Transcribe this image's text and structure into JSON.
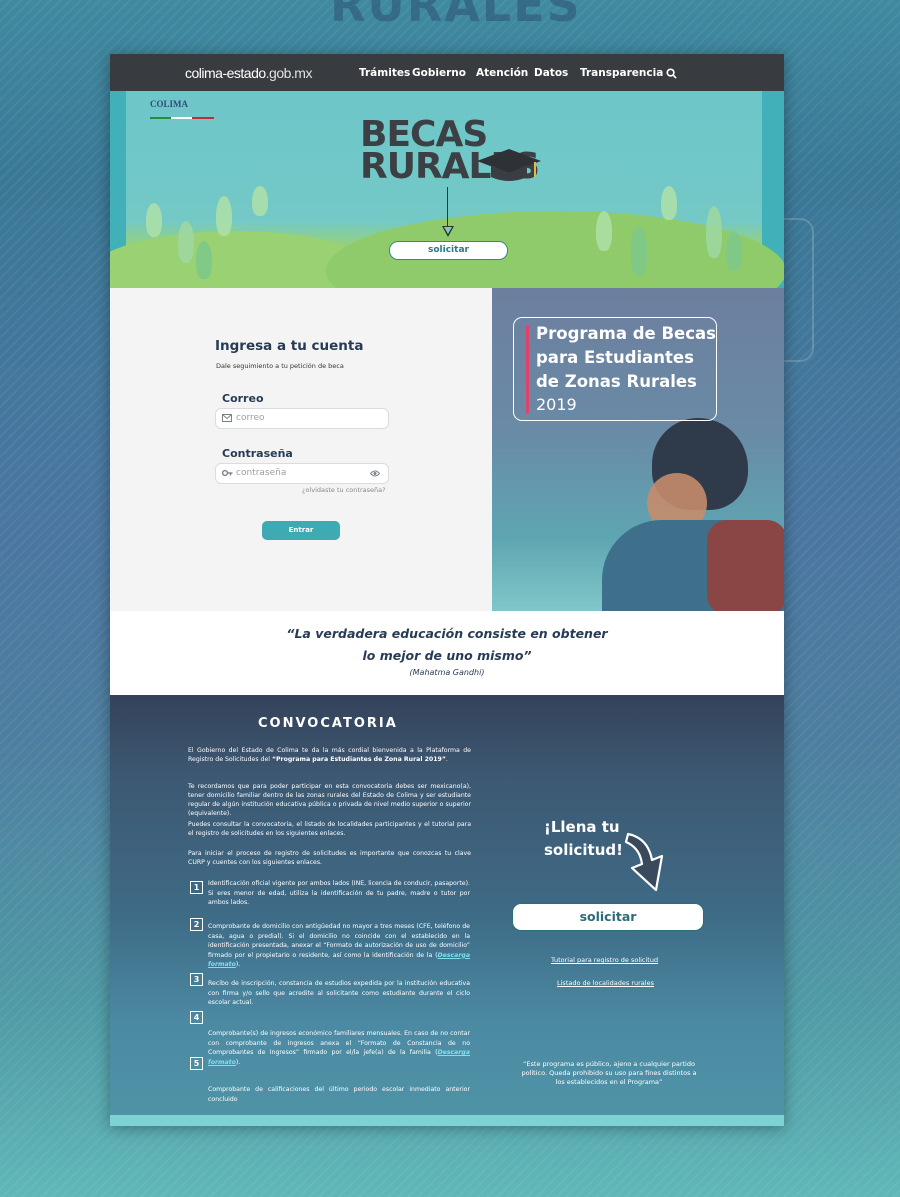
{
  "header": {
    "logo_main": "colima-estado",
    "logo_domain": ".gob.mx",
    "nav": [
      "Trámites",
      "Gobierno",
      "Atención",
      "Datos",
      "Transparencia"
    ]
  },
  "hero": {
    "title_line1": "BECAS",
    "title_line2": "RURALES",
    "badge": "COLIMA",
    "button_label": "solicitar"
  },
  "login": {
    "title": "Ingresa a tu cuenta",
    "subtitle": "Dale seguimiento a tu petición de beca",
    "email_label": "Correo",
    "email_placeholder": "correo",
    "password_label": "Contraseña",
    "password_placeholder": "contraseña",
    "forgot": "¿olvidaste tu contraseña?",
    "submit": "Entrar"
  },
  "program": {
    "title": "Programa de Becas para Estudiantes de Zonas Rurales",
    "year": "2019"
  },
  "quote": {
    "line1": "“La verdadera educación consiste en obtener",
    "line2": "lo mejor de uno mismo”",
    "author": "(Mahatma Gandhi)"
  },
  "convocatoria": {
    "title": "CONVOCATORIA",
    "intro_pre": "El Gobierno del Estado de Colima te da la más cordial bienvenida a la Plataforma de Registro de Solicitudes del ",
    "intro_bold": "“Programa para Estudiantes de Zona Rural 2019”",
    "intro_post": ".",
    "p2": "Te recordamos que para poder participar en esta convocatoria debes ser mexicano(a), tener domicilio familiar dentro de las zonas rurales del Estado de Colima y ser estudiante regular de algún institución educativa pública o privada de nivel medio superior o superior (equivalente).",
    "p3": "Puedes consultar la convocatoria, el listado de localidades participantes y el tutorial para el registro de solicitudes en los siguientes enlaces.",
    "p4": "Para iniciar el proceso de registro de solicitudes es importante que conozcas tu clave CURP y cuentes con los siguientes enlaces.",
    "items": [
      {
        "num": "1",
        "text": "Identificación oficial vigente por ambos lados (INE, licencia de conducir, pasaporte). Si eres menor de edad, utiliza la identificación de tu padre, madre o tutor por ambos lados."
      },
      {
        "num": "2",
        "text": "Comprobante de domicilio con antigüedad no mayor a tres meses (CFE, teléfono de casa, agua o predial). Si el domicilio no coincide con el establecido en la identificación presentada, anexar el “Formato de autorización de uso de domicilio” firmado por el propietario o residente, así como la identificación de la ",
        "link": "Descarga formato",
        "tail": ")."
      },
      {
        "num": "3",
        "text": "Recibo de inscripción, constancia de estudios expedida por la institución educativa con firma y/o sello que acredite al solicitante como estudiante durante el ciclo escolar actual."
      },
      {
        "num": "4",
        "text": "Comprobante(s) de ingresos económico familiares mensuales. En caso de no contar con comprobante de ingresos anexa el “Formato de Constancia de no Comprobantes de Ingresos” firmado por el/la jefe(a) de la familia (",
        "link": "Descarga formato",
        "tail": ")."
      },
      {
        "num": "5",
        "text": "Comprobante de calificaciones del último periodo escolar inmediato anterior concluido"
      }
    ],
    "cta_line1": "¡Llena tu",
    "cta_line2": "solicitud!",
    "cta_button": "solicitar",
    "link_tutorial": "Tutorial para registro de solicitud",
    "link_localidades": "Listado de localidades rurales",
    "disclaimer": "“Este programa es público, ajeno a cualquier partido político. Queda prohibido su uso para fines distintos a los establecidos en el Programa”"
  },
  "colors": {
    "teal": "#3eaab2",
    "navy": "#283b55",
    "accent": "#e0406a"
  }
}
